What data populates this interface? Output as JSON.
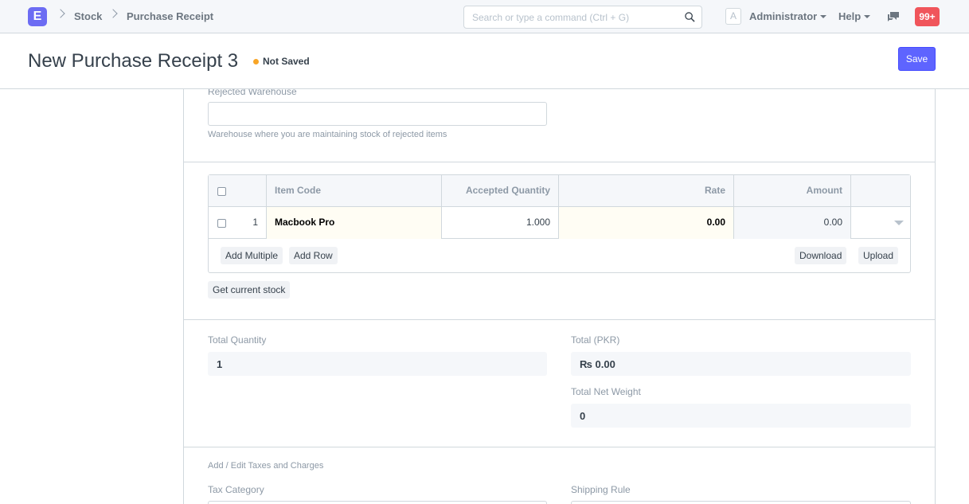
{
  "navbar": {
    "logo": "E",
    "breadcrumbs": [
      "Stock",
      "Purchase Receipt"
    ],
    "search_placeholder": "Search or type a command (Ctrl + G)",
    "avatar_letter": "A",
    "user": "Administrator",
    "help": "Help",
    "notifications": "99+"
  },
  "page": {
    "title": "New Purchase Receipt 3",
    "status": "Not Saved",
    "save": "Save"
  },
  "warehouse": {
    "label": "Rejected Warehouse",
    "value": "",
    "help": "Warehouse where you are maintaining stock of rejected items"
  },
  "items_table": {
    "columns": [
      "Item Code",
      "Accepted Quantity",
      "Rate",
      "Amount"
    ],
    "rows": [
      {
        "idx": "1",
        "item_code": "Macbook Pro",
        "accepted_qty": "1.000",
        "rate": "0.00",
        "amount": "0.00"
      }
    ],
    "add_multiple": "Add Multiple",
    "add_row": "Add Row",
    "download": "Download",
    "upload": "Upload"
  },
  "get_current_stock": "Get current stock",
  "totals": {
    "total_qty_label": "Total Quantity",
    "total_qty": "1",
    "total_label": "Total (PKR)",
    "total": "₨ 0.00",
    "net_weight_label": "Total Net Weight",
    "net_weight": "0"
  },
  "taxes": {
    "section_title": "Add / Edit Taxes and Charges",
    "tax_category_label": "Tax Category",
    "shipping_rule_label": "Shipping Rule"
  },
  "colors": {
    "primary": "#5e64ff",
    "logo": "#6c6cf3",
    "not_saved_dot": "#f8a526",
    "notification": "#f0555b"
  }
}
